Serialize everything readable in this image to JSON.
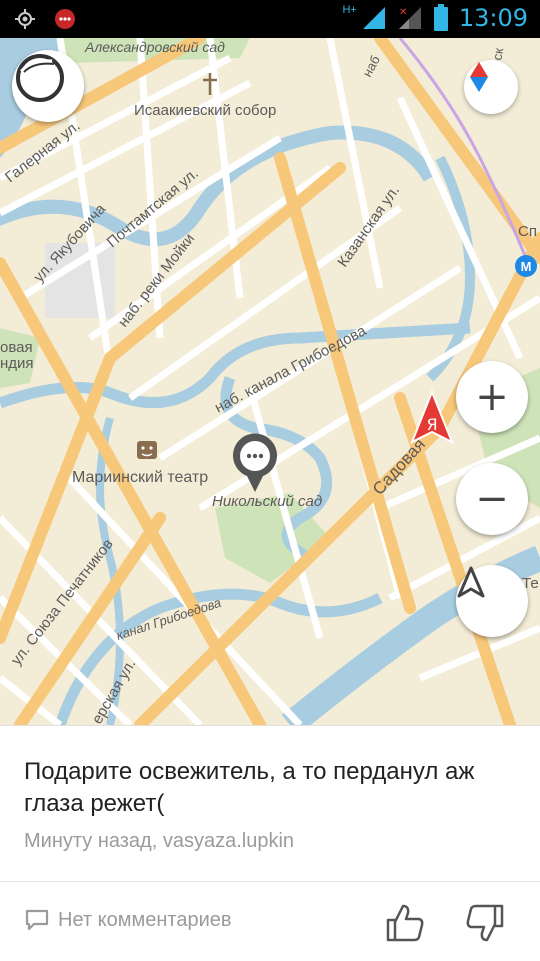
{
  "status_bar": {
    "time": "13:09",
    "network_label": "H+",
    "icons": [
      "gps-icon",
      "app-notification-icon",
      "network-hplus-icon",
      "signal-no-data-icon",
      "signal-bars-icon",
      "battery-icon"
    ]
  },
  "map": {
    "labels": {
      "aleksandrovsky_sad": "Александровский сад",
      "isaakievsky_sobor": "Исаакиевский собор",
      "galernaya": "Галерная ул.",
      "pochtamtskaya": "Почтамтская ул.",
      "yakubovicha": "ул. Якубовича",
      "moika": "наб. реки Мойки",
      "kazanskaya": "Казанская ул.",
      "griboedova_nab": "наб. канала Грибоедова",
      "kanal_griboedova": "канал Грибоедова",
      "mariinsky": "Мариинский театр",
      "nikolsky_sad": "Никольский сад",
      "sadovaya": "Садовая",
      "soyuza_pechatnikov": "ул. Союза Печатников",
      "dekabristov_partial": "ерская ул.",
      "novaya_gollandiya_1": "овая",
      "novaya_gollandiya_2": "ндия",
      "metro_partial": "Сп",
      "top_nab_partial": "наб",
      "right_edge_partial": "Те",
      "top_right_partial": "еск"
    }
  },
  "controls": {
    "zoom_in": "+",
    "zoom_out": "−"
  },
  "post": {
    "text": "Подарите освежитель, а то перданул аж глаза режет(",
    "meta": "Минуту назад, vasyaza.lupkin",
    "comments_label": "Нет комментариев"
  },
  "colors": {
    "land": "#f3ecd6",
    "water": "#a9cde0",
    "major_road": "#f7c77a",
    "street": "#ffffff",
    "park": "#cfe3b8",
    "accent_red": "#e53935"
  }
}
